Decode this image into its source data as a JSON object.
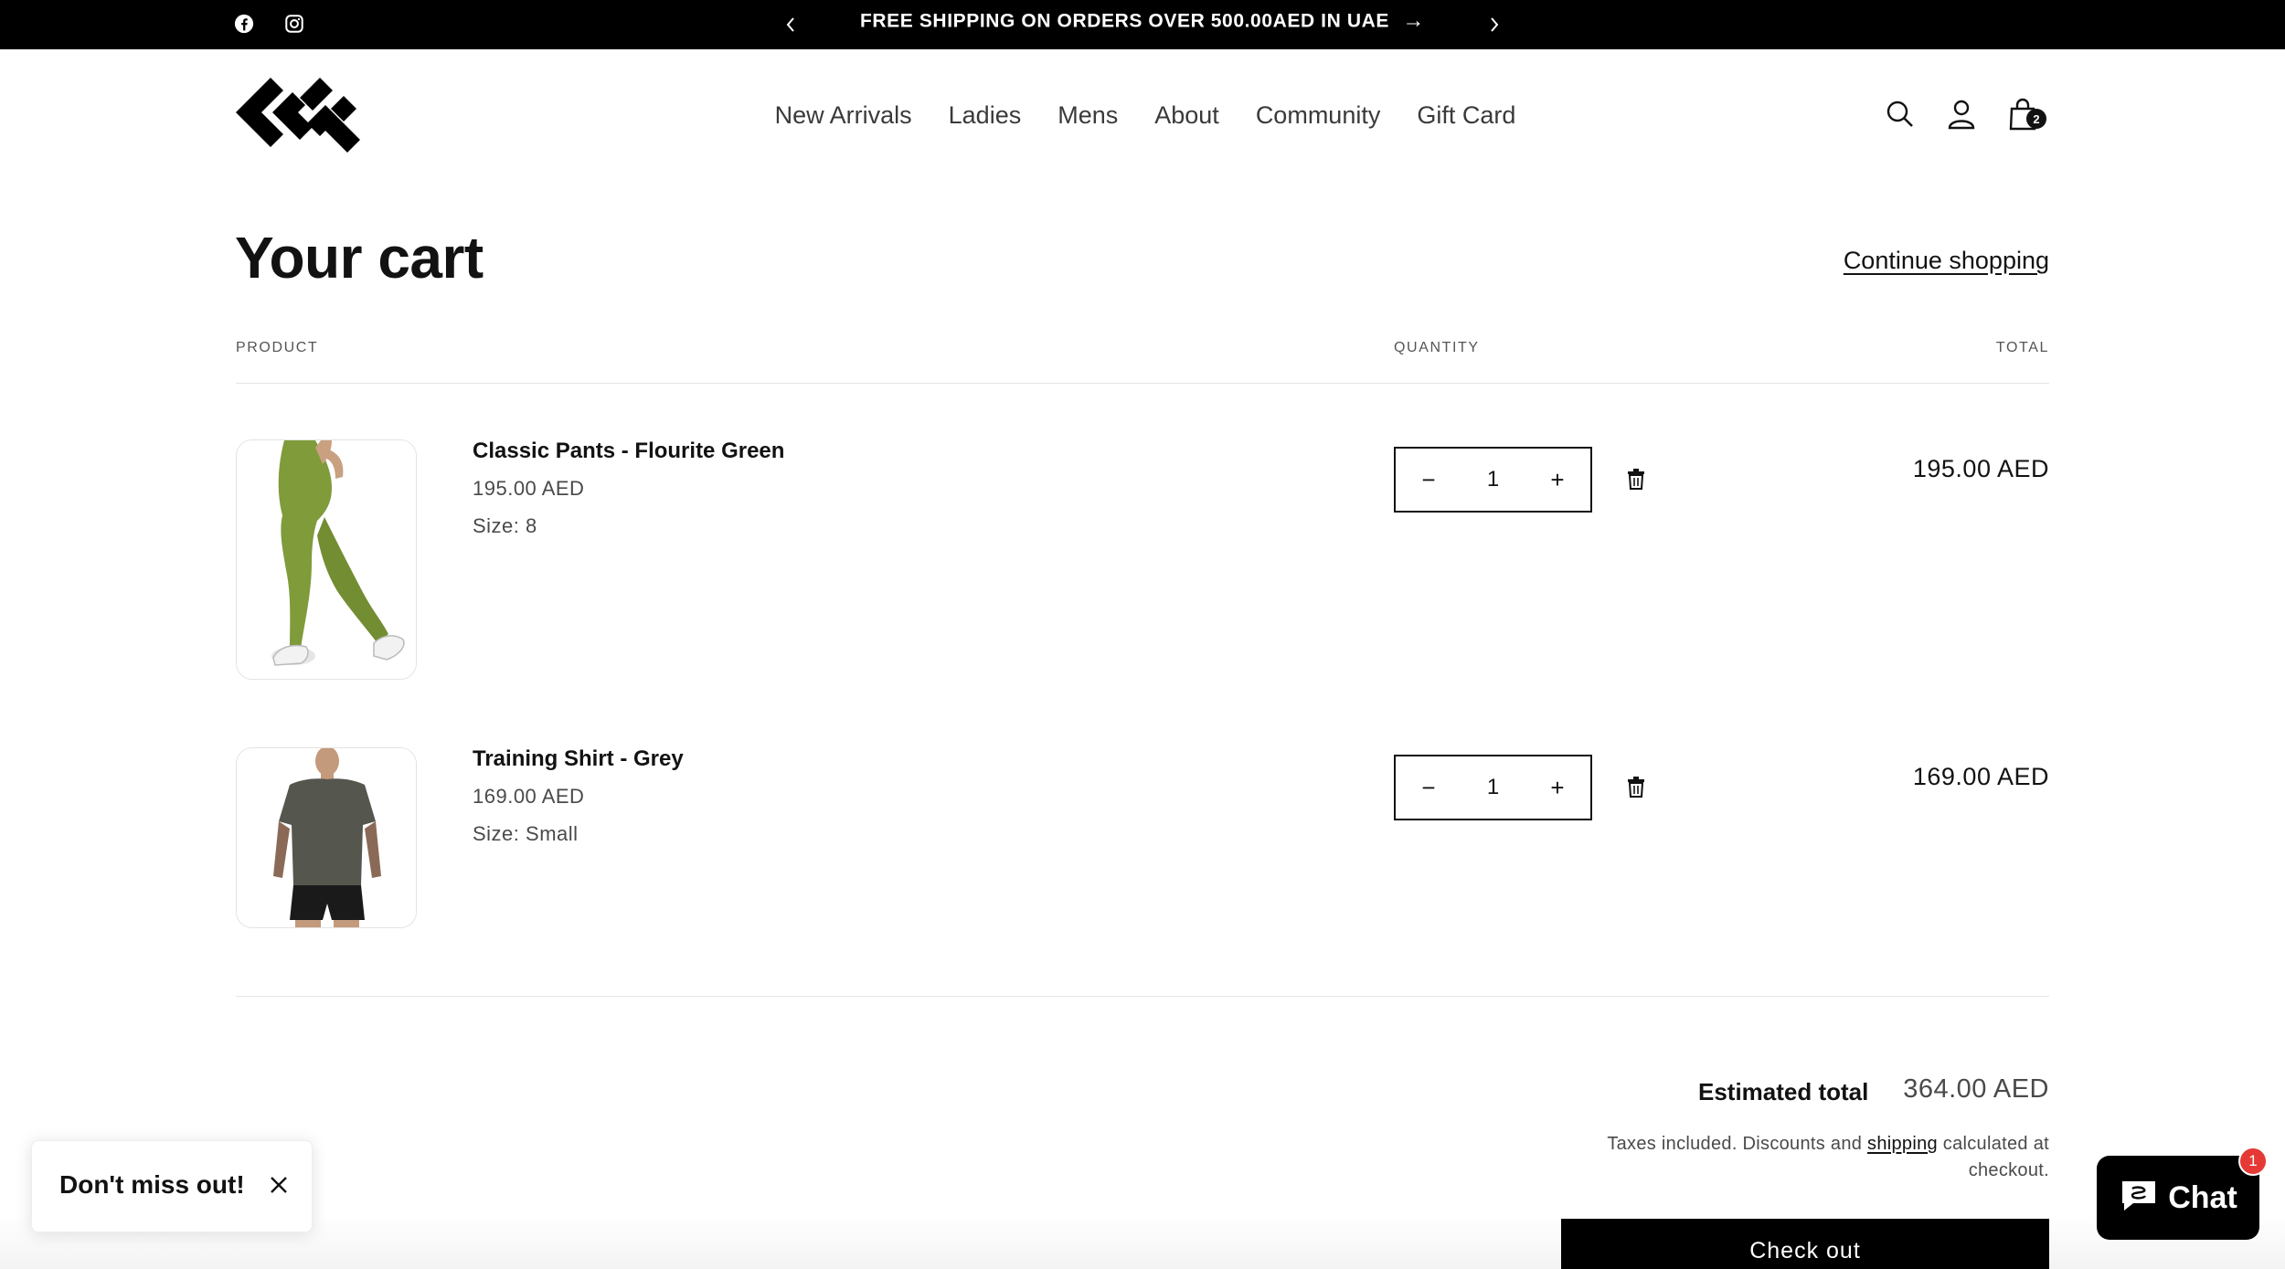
{
  "announcement": {
    "text": "FREE SHIPPING ON ORDERS OVER 500.00AED IN UAE",
    "arrow": "→",
    "prev": "‹",
    "next": "›",
    "social_icons": [
      "facebook-icon",
      "instagram-icon"
    ]
  },
  "nav": {
    "items": [
      {
        "label": "New Arrivals"
      },
      {
        "label": "Ladies"
      },
      {
        "label": "Mens"
      },
      {
        "label": "About"
      },
      {
        "label": "Community"
      },
      {
        "label": "Gift Card"
      }
    ],
    "cart_count": "2"
  },
  "cart": {
    "title": "Your cart",
    "continue_label": "Continue shopping",
    "headers": {
      "product": "PRODUCT",
      "quantity": "QUANTITY",
      "total": "TOTAL"
    },
    "items": [
      {
        "name": "Classic Pants - Flourite Green",
        "price": "195.00 AED",
        "size": "Size: 8",
        "quantity": "1",
        "total": "195.00 AED",
        "minus": "−",
        "plus": "+"
      },
      {
        "name": "Training Shirt - Grey",
        "price": "169.00 AED",
        "size": "Size: Small",
        "quantity": "1",
        "total": "169.00 AED",
        "minus": "−",
        "plus": "+"
      }
    ],
    "estimated_label": "Estimated total",
    "estimated_value": "364.00 AED",
    "tax_before": "Taxes included. Discounts and ",
    "tax_link": "shipping",
    "tax_after": " calculated at checkout.",
    "checkout_label": "Check out"
  },
  "popup": {
    "text": "Don't miss out!"
  },
  "chat": {
    "label": "Chat",
    "badge": "1"
  },
  "colors": {
    "accent": "#000000",
    "badge": "#e53935",
    "pants": "#7f9b3a",
    "shirt": "#55574f"
  }
}
